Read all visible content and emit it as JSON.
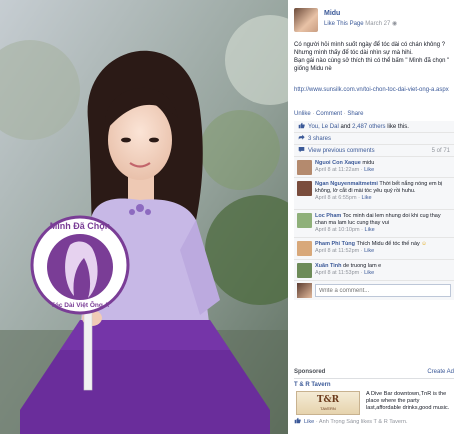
{
  "photo": {
    "badge_line1": "Mình Đã Chọn",
    "badge_line2": "Tóc Dài Việt Ông A"
  },
  "post": {
    "author": "Midu",
    "like_page": "Like This Page",
    "date": "March 27",
    "text_line1": "Có người hỏi mình suốt ngày để tóc dài có chán không ? Nhưng mình thấy để tóc dài nhìn sự mà hihi.",
    "text_line2": "Bạn gái nào cùng sở thích thì có thể bấm \" Mình đã chọn \" giống Midu nè",
    "link": "http://www.sunsilk.com.vn/toi-chon-toc-dai-viet-ong-a.aspx",
    "actions": [
      "Unlike",
      "Comment",
      "Share"
    ]
  },
  "ufi": {
    "likes": {
      "you": "You,",
      "friend": "Le Dal",
      "and": "and",
      "others": "2,487 others",
      "tail": "like this."
    },
    "shares": "3 shares",
    "view_previous": "View previous comments",
    "counter": "5 of 71"
  },
  "comments": [
    {
      "name": "Nguoi Con Xaque",
      "text": "midu",
      "time": "April 8 at 11:22am",
      "like": "Like",
      "avatar": "#b48a6e"
    },
    {
      "name": "Ngan Nguyenmaitmetmi",
      "text": "Thời bết nắng nóng em bị không, lờ cắt đi mài tóc yêu quý rồi huhu.",
      "time": "April 8 at 6:55pm",
      "like": "Like",
      "avatar": "#7a4d3d"
    },
    {
      "name": "Loc Pham",
      "text": "Toc minh dai lem nhung doi khi cug thay chan ma lam luc cung thay vui",
      "time": "April 8 at 10:10pm",
      "like": "Like",
      "avatar": "#8fb07a"
    },
    {
      "name": "Pham Phi Tùng",
      "text": "Thích Midu để tóc thế này",
      "time": "April 8 at 11:52pm",
      "like": "Like",
      "avatar": "#d8a87a"
    },
    {
      "name": "Xuân Tinh",
      "text": "de truong lam e",
      "time": "April 8 at 11:53pm",
      "like": "Like",
      "avatar": "#6d8b58"
    }
  ],
  "composer": {
    "placeholder": "Write a comment..."
  },
  "sponsored": {
    "label": "Sponsored",
    "create_ad": "Create Ad",
    "ad_title": "T & R Tavern",
    "ad_image_brand": "T&R",
    "ad_image_sub": "TAVERN",
    "ad_text": "A Dive Bar downtown,TnR is the place where the party last,affordable drinks,good music.",
    "social_like": "Like",
    "social_text": "· Anh Trọng Sáng likes T & R Tavern."
  },
  "colors": {
    "fb_blue": "#3b5998",
    "badge_purple": "#7a3d96",
    "skirt_purple": "#6a2d9b",
    "sweater_lavender": "#c5b5e4"
  },
  "icons": [
    "thumbs-up-icon",
    "share-icon",
    "comment-icon",
    "smiley-icon"
  ]
}
